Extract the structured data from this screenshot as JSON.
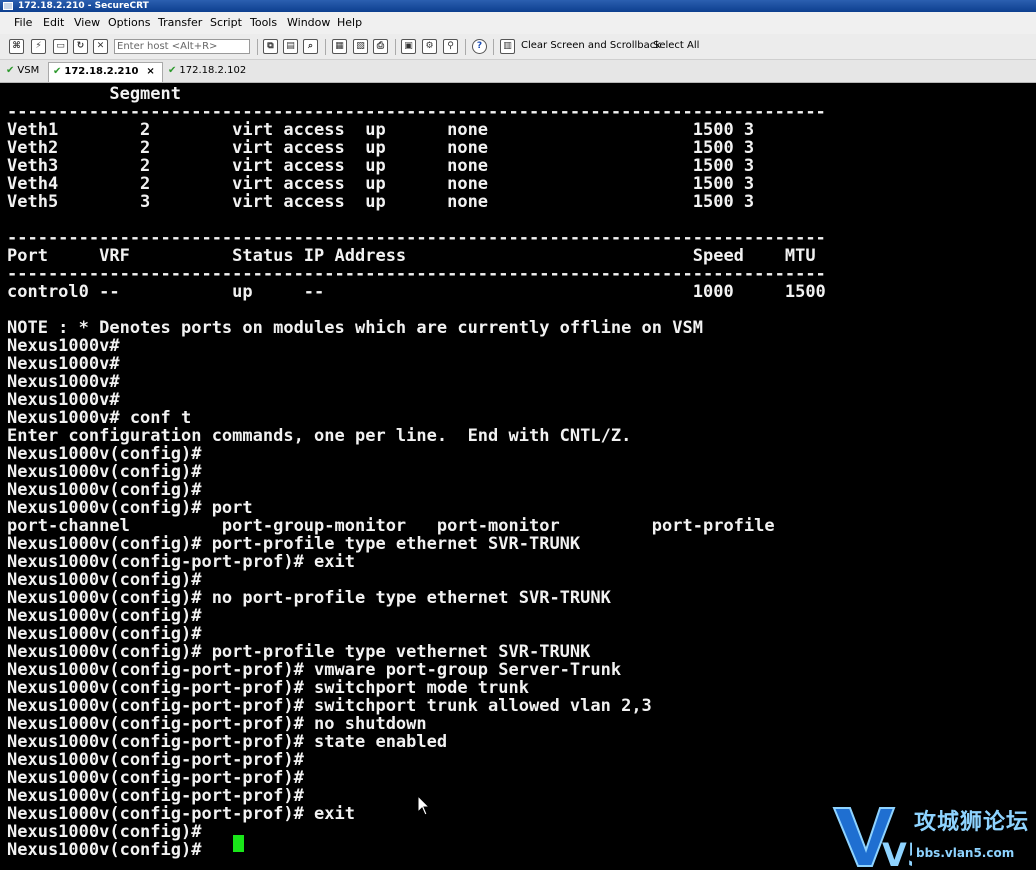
{
  "window": {
    "title": "172.18.2.210 - SecureCRT"
  },
  "menu": [
    "File",
    "Edit",
    "View",
    "Options",
    "Transfer",
    "Script",
    "Tools",
    "Window",
    "Help"
  ],
  "toolbar": {
    "host_placeholder": "Enter host <Alt+R>",
    "clear_label": "Clear Screen and Scrollback",
    "select_all_label": "Select All"
  },
  "tabs": [
    {
      "label": "VSM",
      "active": false
    },
    {
      "label": "172.18.2.210",
      "active": true,
      "close": "×"
    },
    {
      "label": "172.18.2.102",
      "active": false
    }
  ],
  "terminal": {
    "lines": [
      "          Segment",
      "--------------------------------------------------------------------------------",
      "Veth1        2        virt access  up      none                    1500 3",
      "Veth2        2        virt access  up      none                    1500 3",
      "Veth3        2        virt access  up      none                    1500 3",
      "Veth4        2        virt access  up      none                    1500 3",
      "Veth5        3        virt access  up      none                    1500 3",
      "",
      "--------------------------------------------------------------------------------",
      "Port     VRF          Status IP Address                            Speed    MTU",
      "--------------------------------------------------------------------------------",
      "control0 --           up     --                                    1000     1500",
      "",
      "NOTE : * Denotes ports on modules which are currently offline on VSM",
      "Nexus1000v#",
      "Nexus1000v#",
      "Nexus1000v#",
      "Nexus1000v#",
      "Nexus1000v# conf t",
      "Enter configuration commands, one per line.  End with CNTL/Z.",
      "Nexus1000v(config)#",
      "Nexus1000v(config)#",
      "Nexus1000v(config)#",
      "Nexus1000v(config)# port",
      "port-channel         port-group-monitor   port-monitor         port-profile",
      "Nexus1000v(config)# port-profile type ethernet SVR-TRUNK",
      "Nexus1000v(config-port-prof)# exit",
      "Nexus1000v(config)#",
      "Nexus1000v(config)# no port-profile type ethernet SVR-TRUNK",
      "Nexus1000v(config)#",
      "Nexus1000v(config)#",
      "Nexus1000v(config)# port-profile type vethernet SVR-TRUNK",
      "Nexus1000v(config-port-prof)# vmware port-group Server-Trunk",
      "Nexus1000v(config-port-prof)# switchport mode trunk",
      "Nexus1000v(config-port-prof)# switchport trunk allowed vlan 2,3",
      "Nexus1000v(config-port-prof)# no shutdown",
      "Nexus1000v(config-port-prof)# state enabled",
      "Nexus1000v(config-port-prof)#",
      "Nexus1000v(config-port-prof)#",
      "Nexus1000v(config-port-prof)#",
      "Nexus1000v(config-port-prof)# exit",
      "Nexus1000v(config)#",
      "Nexus1000v(config)# "
    ]
  },
  "watermark": {
    "logo_text": "V5",
    "title": "攻城狮论坛",
    "url": "bbs.vlan5.com"
  },
  "colors": {
    "terminal_bg": "#000000",
    "terminal_fg": "#f2f2f2",
    "cursor": "#19e619",
    "watermark": "#8ed3ff"
  }
}
